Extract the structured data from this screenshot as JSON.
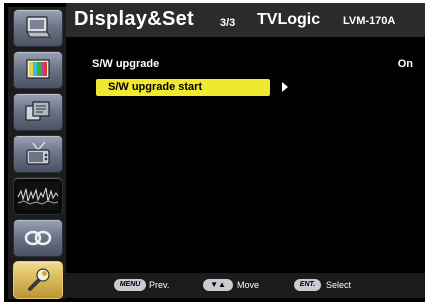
{
  "header": {
    "title": "Display&Set",
    "page": "3/3",
    "brand": "TVLogic",
    "model": "LVM-170A"
  },
  "sidebar": {
    "items": [
      {
        "icon": "monitor-icon",
        "active": false
      },
      {
        "icon": "color-bars-icon",
        "active": false
      },
      {
        "icon": "windows-icon",
        "active": false
      },
      {
        "icon": "tv-antenna-icon",
        "active": false
      },
      {
        "icon": "waveform-icon",
        "active": false
      },
      {
        "icon": "link-icon",
        "active": false
      },
      {
        "icon": "wrench-icon",
        "active": true
      }
    ]
  },
  "main": {
    "setting_label": "S/W upgrade",
    "setting_value": "On",
    "selected_item": "S/W upgrade start"
  },
  "footer": {
    "menu_key": "MENU",
    "menu_label": "Prev.",
    "move_key": "▼▲",
    "move_label": "Move",
    "enter_key": "ENT.",
    "enter_label": "Select"
  },
  "colors": {
    "highlight": "#f1e830",
    "active_tab": "#d8b85a",
    "tab": "#6d7689",
    "header_bg": "#2b2b2b"
  }
}
